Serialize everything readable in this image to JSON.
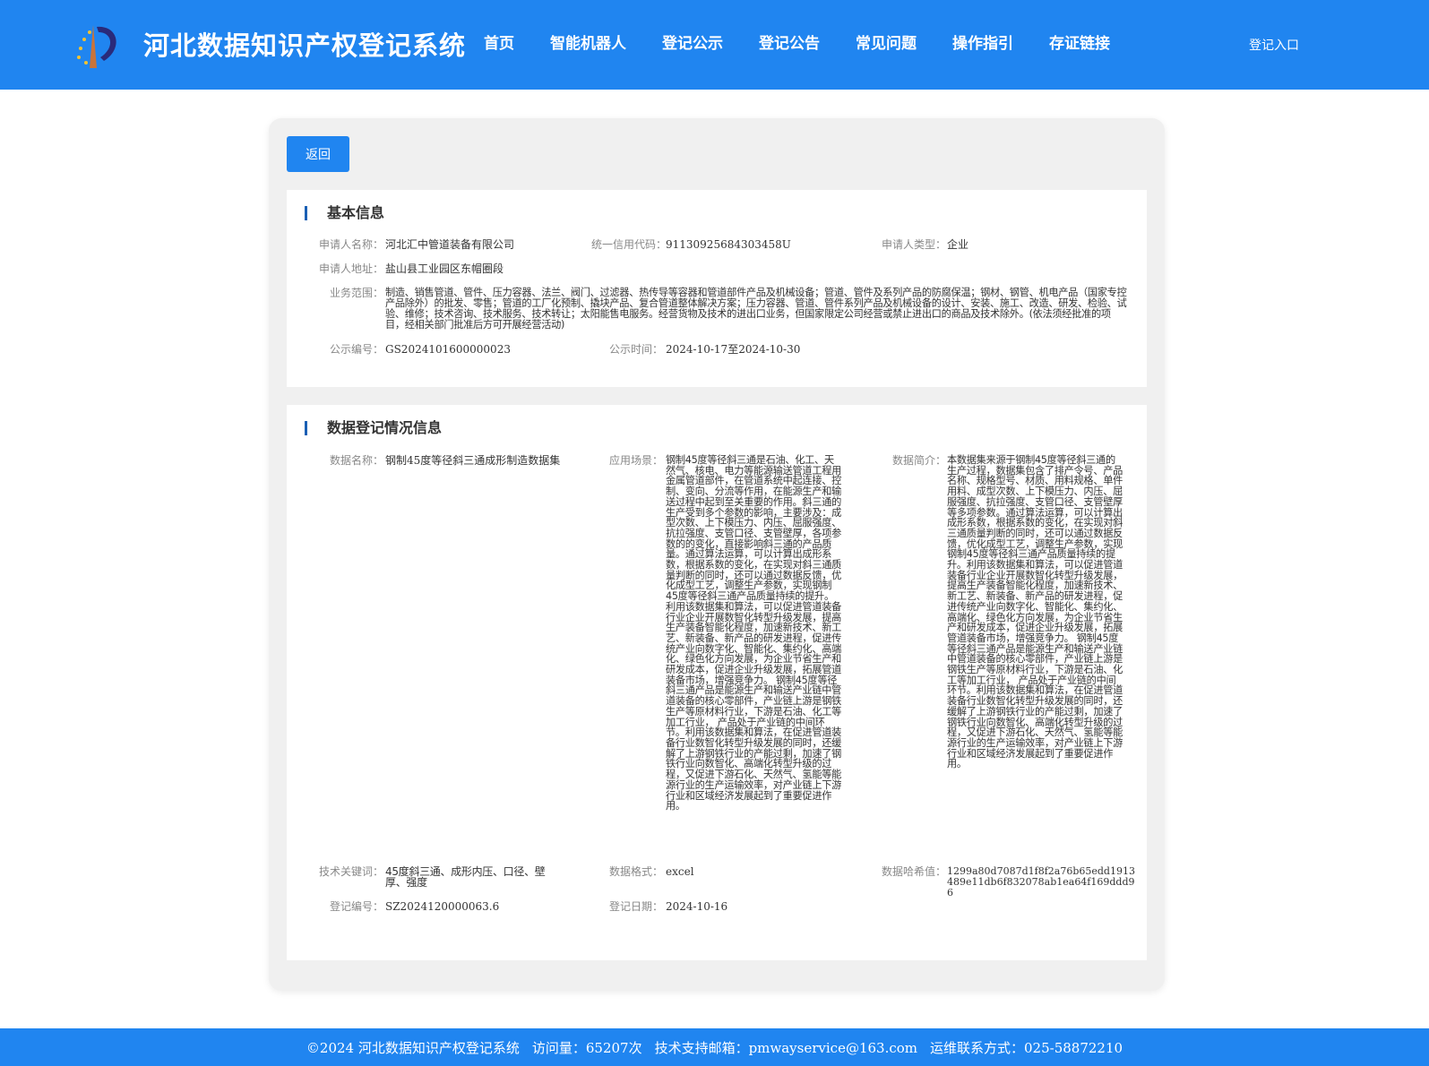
{
  "header": {
    "title": "河北数据知识产权登记系统",
    "nav": [
      "首页",
      "智能机器人",
      "登记公示",
      "登记公告",
      "常见问题",
      "操作指引",
      "存证链接"
    ],
    "login": "登记入口"
  },
  "back_label": "返回",
  "basic": {
    "title": "基本信息",
    "applicant_name_label": "申请人名称：",
    "applicant_name": "河北汇中管道装备有限公司",
    "credit_code_label": "统一信用代码：",
    "credit_code": "91130925684303458U",
    "applicant_type_label": "申请人类型：",
    "applicant_type": "企业",
    "address_label": "申请人地址：",
    "address": "盐山县工业园区东帽圈段",
    "scope_label": "业务范围：",
    "scope": "制造、销售管道、管件、压力容器、法兰、阀门、过滤器、热传导等容器和管道部件产品及机械设备；管道、管件及系列产品的防腐保温；钢材、钢管、机电产品（国家专控产品除外）的批发、零售；管道的工厂化预制、撬块产品、复合管道整体解决方案；压力容器、管道、管件系列产品及机械设备的设计、安装、施工、改造、研发、检验、试验、维修；技术咨询、技术服务、技术转让；太阳能售电服务。经营货物及技术的进出口业务，但国家限定公司经营或禁止进出口的商品及技术除外。(依法须经批准的项目，经相关部门批准后方可开展经营活动)",
    "pub_no_label": "公示编号：",
    "pub_no": "GS2024101600000023",
    "pub_time_label": "公示时间：",
    "pub_time": "2024-10-17至2024-10-30"
  },
  "data_reg": {
    "title": "数据登记情况信息",
    "name_label": "数据名称：",
    "name": "钢制45度等径斜三通成形制造数据集",
    "scene_label": "应用场景：",
    "scene": "钢制45度等径斜三通是石油、化工、天然气、核电、电力等能源输送管道工程用金属管道部件，在管道系统中起连接、控制、变向、分流等作用，在能源生产和输送过程中起到至关重要的作用。斜三通的生产受到多个参数的影响，主要涉及：成型次数、上下模压力、内压、屈服强度、抗拉强度、支管口径、支管壁厚，各项参数的的变化，直接影响斜三通的产品质量。通过算法运算，可以计算出成形系数，根据系数的变化，在实现对斜三通质量判断的同时，还可以通过数据反馈，优化成型工艺，调整生产参数，实现钢制45度等径斜三通产品质量持续的提升。利用该数据集和算法，可以促进管道装备行业企业开展数智化转型升级发展，提高生产装备智能化程度，加速新技术、新工艺、新装备、新产品的研发进程，促进传统产业向数字化、智能化、集约化、高端化、绿色化方向发展，为企业节省生产和研发成本，促进企业升级发展，拓展管道装备市场，增强竞争力。 钢制45度等径斜三通产品是能源生产和输送产业链中管道装备的核心零部件，产业链上游是钢铁生产等原材料行业，下游是石油、化工等加工行业， 产品处于产业链的中间环节。利用该数据集和算法，在促进管道装备行业数智化转型升级发展的同时，还缓解了上游钢铁行业的产能过剩，加速了钢铁行业向数智化、高端化转型升级的过程，又促进下游石化、天然气、氢能等能源行业的生产运输效率，对产业链上下游行业和区域经济发展起到了重要促进作用。",
    "intro_label": "数据简介：",
    "intro": "本数据集来源于钢制45度等径斜三通的生产过程，数据集包含了排产令号、产品名称、规格型号、材质、用料规格、单件用料、成型次数、上下模压力、内压、屈服强度、抗拉强度、支管口径、支管壁厚等多项参数。通过算法运算，可以计算出成形系数，根据系数的变化，在实现对斜三通质量判断的同时，还可以通过数据反馈，优化成型工艺，调整生产参数，实现钢制45度等径斜三通产品质量持续的提升。利用该数据集和算法，可以促进管道装备行业企业开展数智化转型升级发展，提高生产装备智能化程度，加速新技术、新工艺、新装备、新产品的研发进程，促进传统产业向数字化、智能化、集约化、高端化、绿色化方向发展，为企业节省生产和研发成本，促进企业升级发展，拓展管道装备市场，增强竞争力。 钢制45度等径斜三通产品是能源生产和输送产业链中管道装备的核心零部件，产业链上游是钢铁生产等原材料行业，下游是石油、化工等加工行业， 产品处于产业链的中间环节。利用该数据集和算法，在促进管道装备行业数智化转型升级发展的同时，还缓解了上游钢铁行业的产能过剩，加速了钢铁行业向数智化、高端化转型升级的过程，又促进下游石化、天然气、氢能等能源行业的生产运输效率，对产业链上下游行业和区域经济发展起到了重要促进作用。",
    "keywords_label": "技术关键词：",
    "keywords": "45度斜三通、成形内压、口径、壁厚、强度",
    "format_label": "数据格式：",
    "format": "excel",
    "hash_label": "数据哈希值：",
    "hash": "1299a80d7087d1f8f2a76b65edd1913489e11db6f832078ab1ea64f169ddd96",
    "reg_no_label": "登记编号：",
    "reg_no": "SZ2024120000063.6",
    "reg_date_label": "登记日期：",
    "reg_date": "2024-10-16"
  },
  "footer": {
    "copyright": "©2024 河北数据知识产权登记系统",
    "visits": "访问量：65207次",
    "email": "技术支持邮箱：pmwayservice@163.com",
    "phone": "运维联系方式：025-58872210"
  }
}
